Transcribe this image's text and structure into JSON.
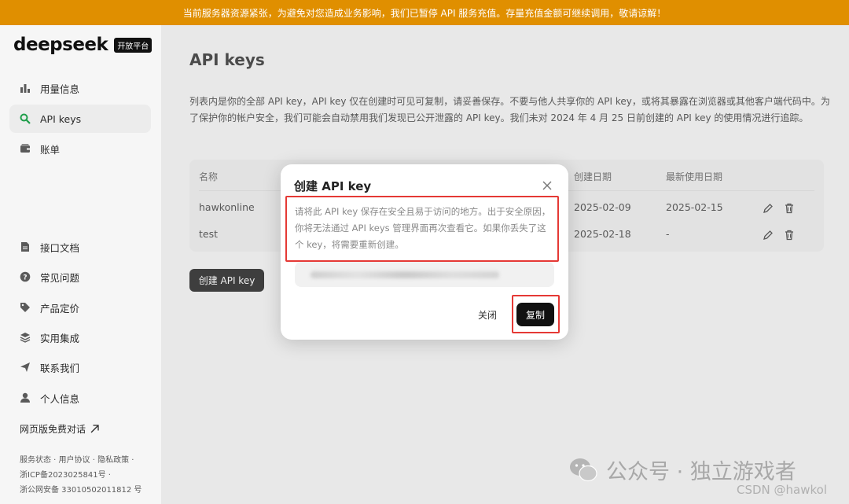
{
  "banner": {
    "text": "当前服务器资源紧张，为避免对您造成业务影响，我们已暂停 API 服务充值。存量充值金额可继续调用，敬请谅解！"
  },
  "brand": {
    "name": "deepseek",
    "badge": "开放平台"
  },
  "sidebar": {
    "top_items": [
      {
        "label": "用量信息",
        "icon": "bar-chart-icon"
      },
      {
        "label": "API keys",
        "icon": "search-key-icon",
        "active": true
      },
      {
        "label": "账单",
        "icon": "wallet-icon"
      }
    ],
    "bottom_items": [
      {
        "label": "接口文档",
        "icon": "document-icon"
      },
      {
        "label": "常见问题",
        "icon": "help-icon"
      },
      {
        "label": "产品定价",
        "icon": "tag-icon"
      },
      {
        "label": "实用集成",
        "icon": "layers-icon"
      },
      {
        "label": "联系我们",
        "icon": "send-icon"
      },
      {
        "label": "个人信息",
        "icon": "user-icon"
      }
    ],
    "web_chat": "网页版免费对话",
    "footer": {
      "links": "服务状态 · 用户协议 · 隐私政策 ·",
      "icp": "浙ICP备2023025841号 ·",
      "gongan": "浙公网安备 33010502011812 号"
    }
  },
  "main": {
    "title": "API keys",
    "description": "列表内是你的全部 API key，API key 仅在创建时可见可复制，请妥善保存。不要与他人共享你的 API key，或将其暴露在浏览器或其他客户端代码中。为了保护你的帐户安全，我们可能会自动禁用我们发现已公开泄露的 API key。我们未对 2024 年 4 月 25 日前创建的 API key 的使用情况进行追踪。",
    "table": {
      "headers": {
        "name": "名称",
        "created": "创建日期",
        "last_used": "最新使用日期"
      },
      "rows": [
        {
          "name": "hawkonline",
          "created": "2025-02-09",
          "last_used": "2025-02-15"
        },
        {
          "name": "test",
          "created": "2025-02-18",
          "last_used": "-"
        }
      ]
    },
    "create_button": "创建 API key"
  },
  "modal": {
    "title": "创建 API key",
    "warning": "请将此 API key 保存在安全且易于访问的地方。出于安全原因，你将无法通过 API keys 管理界面再次查看它。如果你丢失了这个 key，将需要重新创建。",
    "close_label": "关闭",
    "copy_label": "复制",
    "highlight_color": "#e53935"
  },
  "watermark": {
    "text": "公众号 · 独立游戏者",
    "csdn": "CSDN @hawkol"
  },
  "colors": {
    "banner": "#e08f00",
    "primary": "#111111"
  }
}
